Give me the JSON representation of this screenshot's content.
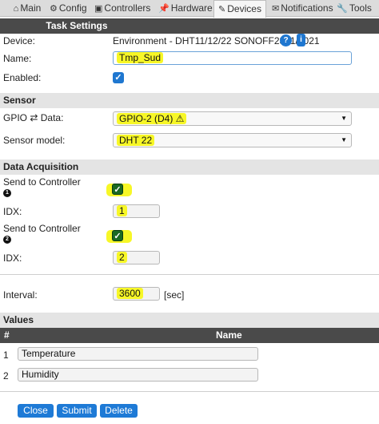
{
  "tabs": [
    {
      "label": "Main",
      "icon": "⌂"
    },
    {
      "label": "Config",
      "icon": "⚙"
    },
    {
      "label": "Controllers",
      "icon": "▣"
    },
    {
      "label": "Hardware",
      "icon": "📌"
    },
    {
      "label": "Devices",
      "icon": "✎"
    },
    {
      "label": "Notifications",
      "icon": "✉"
    },
    {
      "label": "Tools",
      "icon": "🔧"
    }
  ],
  "task_settings": {
    "header": "Task Settings",
    "device_label": "Device:",
    "device_value": "Environment - DHT11/12/22 SONOFF2301/7021",
    "help_icon": "?",
    "info_icon": "i",
    "name_label": "Name:",
    "name_value": "Tmp_Sud",
    "enabled_label": "Enabled:"
  },
  "sensor": {
    "header": "Sensor",
    "gpio_label": "GPIO ⇄ Data:",
    "gpio_value": "GPIO-2 (D4) ⚠",
    "model_label": "Sensor model:",
    "model_value": "DHT 22"
  },
  "data_acquisition": {
    "header": "Data Acquisition",
    "send1_label": "Send to Controller",
    "send1_badge": "1",
    "idx1_label": "IDX:",
    "idx1_value": "1",
    "send2_label": "Send to Controller",
    "send2_badge": "2",
    "idx2_label": "IDX:",
    "idx2_value": "2",
    "interval_label": "Interval:",
    "interval_value": "3600",
    "interval_unit": "[sec]"
  },
  "values": {
    "header": "Values",
    "col_hash": "#",
    "col_name": "Name",
    "rows": [
      {
        "num": "1",
        "name": "Temperature"
      },
      {
        "num": "2",
        "name": "Humidity"
      }
    ]
  },
  "buttons": {
    "close": "Close",
    "submit": "Submit",
    "delete": "Delete"
  },
  "colors": {
    "accent": "#1e7ad6",
    "highlight": "#f7f727",
    "checkbox_green": "#1b6a23",
    "header_dark": "#4a4a4a"
  }
}
